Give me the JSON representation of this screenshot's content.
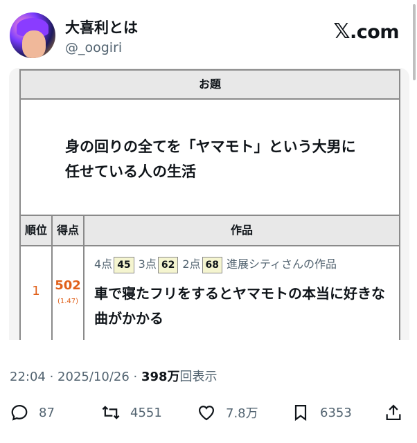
{
  "user": {
    "name": "大喜利とは",
    "handle": "@_oogiri"
  },
  "brand": {
    "logo_text": ".com",
    "logo_mark": "𝕏"
  },
  "card": {
    "odai_header": "お題",
    "odai_text": "身の回りの全てを「ヤマモト」という大男に任せている人の生活",
    "columns": {
      "rank": "順位",
      "score": "得点",
      "work": "作品"
    },
    "entry": {
      "rank": "1",
      "score": "502",
      "average": "(1.47)",
      "p4_label": "4点",
      "p4": "45",
      "p3_label": "3点",
      "p3": "62",
      "p2_label": "2点",
      "p2": "68",
      "author_note": "進展シティさんの作品",
      "text": "車で寝たフリをするとヤマモトの本当に好きな曲がかかる"
    }
  },
  "meta": {
    "time": "22:04 · 2025/10/26 · ",
    "views": "398万",
    "views_label": "回表示"
  },
  "actions": {
    "replies": "87",
    "reposts": "4551",
    "likes": "7.8万",
    "bookmarks": "6353"
  },
  "colors": {
    "accent": "#e0601a",
    "muted": "#536471"
  }
}
